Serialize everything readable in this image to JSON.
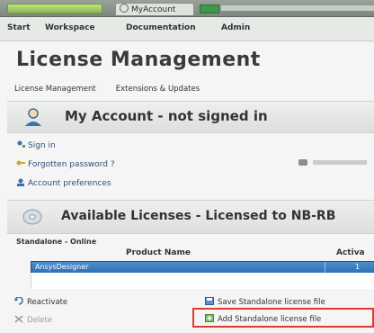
{
  "window": {
    "tab_title": "MyAccount"
  },
  "menu": [
    "Start",
    "Workspace",
    "Documentation",
    "Admin"
  ],
  "page": {
    "title": "License Management"
  },
  "subtabs": [
    "License Management",
    "Extensions & Updates"
  ],
  "account": {
    "title": "My Account - not signed in",
    "links": [
      "Sign in",
      "Forgotten password ?",
      "Account preferences"
    ]
  },
  "licenses": {
    "title": "Available Licenses - Licensed to NB-RB",
    "group_label": "Standalone - Online",
    "columns": [
      "Product Name",
      "Activa"
    ],
    "rows": [
      {
        "name": "AnsysDesigner",
        "active": "1"
      }
    ]
  },
  "actions": {
    "reactivate": "Reactivate",
    "delete": "Delete",
    "save_file": "Save Standalone license file",
    "add_file": "Add Standalone license file"
  }
}
